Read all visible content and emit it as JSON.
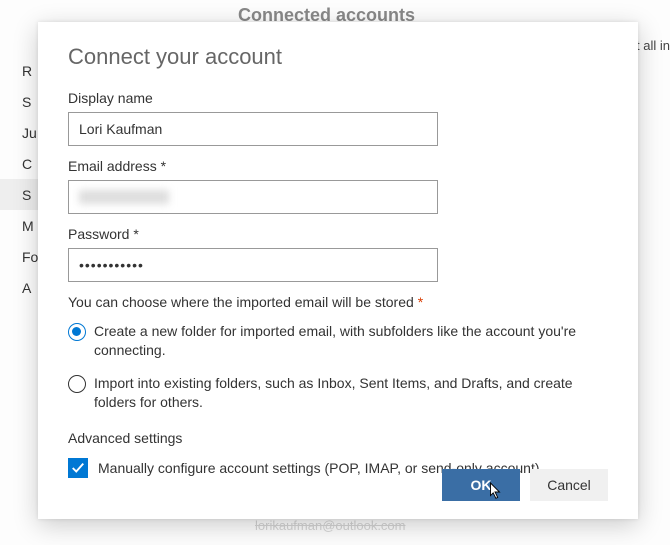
{
  "background": {
    "header": "Connected accounts",
    "rightText": "t all in",
    "bottomEmail": "lorikaufman@outlook.com"
  },
  "sidebar": {
    "items": [
      {
        "label": "R"
      },
      {
        "label": "S"
      },
      {
        "label": "Ju"
      },
      {
        "label": "C"
      },
      {
        "label": "S",
        "selected": true
      },
      {
        "label": "M"
      },
      {
        "label": "Fo"
      },
      {
        "label": "A"
      }
    ]
  },
  "modal": {
    "title": "Connect your account",
    "fields": {
      "displayName": {
        "label": "Display name",
        "value": "Lori Kaufman"
      },
      "email": {
        "label": "Email address *",
        "value": ""
      },
      "password": {
        "label": "Password *",
        "value": "•••••••••••"
      }
    },
    "storageHelp": "You can choose where the imported email will be stored",
    "radios": {
      "createFolder": "Create a new folder for imported email, with subfolders like the account you're connecting.",
      "importExisting": "Import into existing folders, such as Inbox, Sent Items, and Drafts, and create folders for others."
    },
    "advancedLabel": "Advanced settings",
    "manualCheckbox": "Manually configure account settings (POP, IMAP, or send-only account)",
    "buttons": {
      "ok": "OK",
      "cancel": "Cancel"
    }
  }
}
